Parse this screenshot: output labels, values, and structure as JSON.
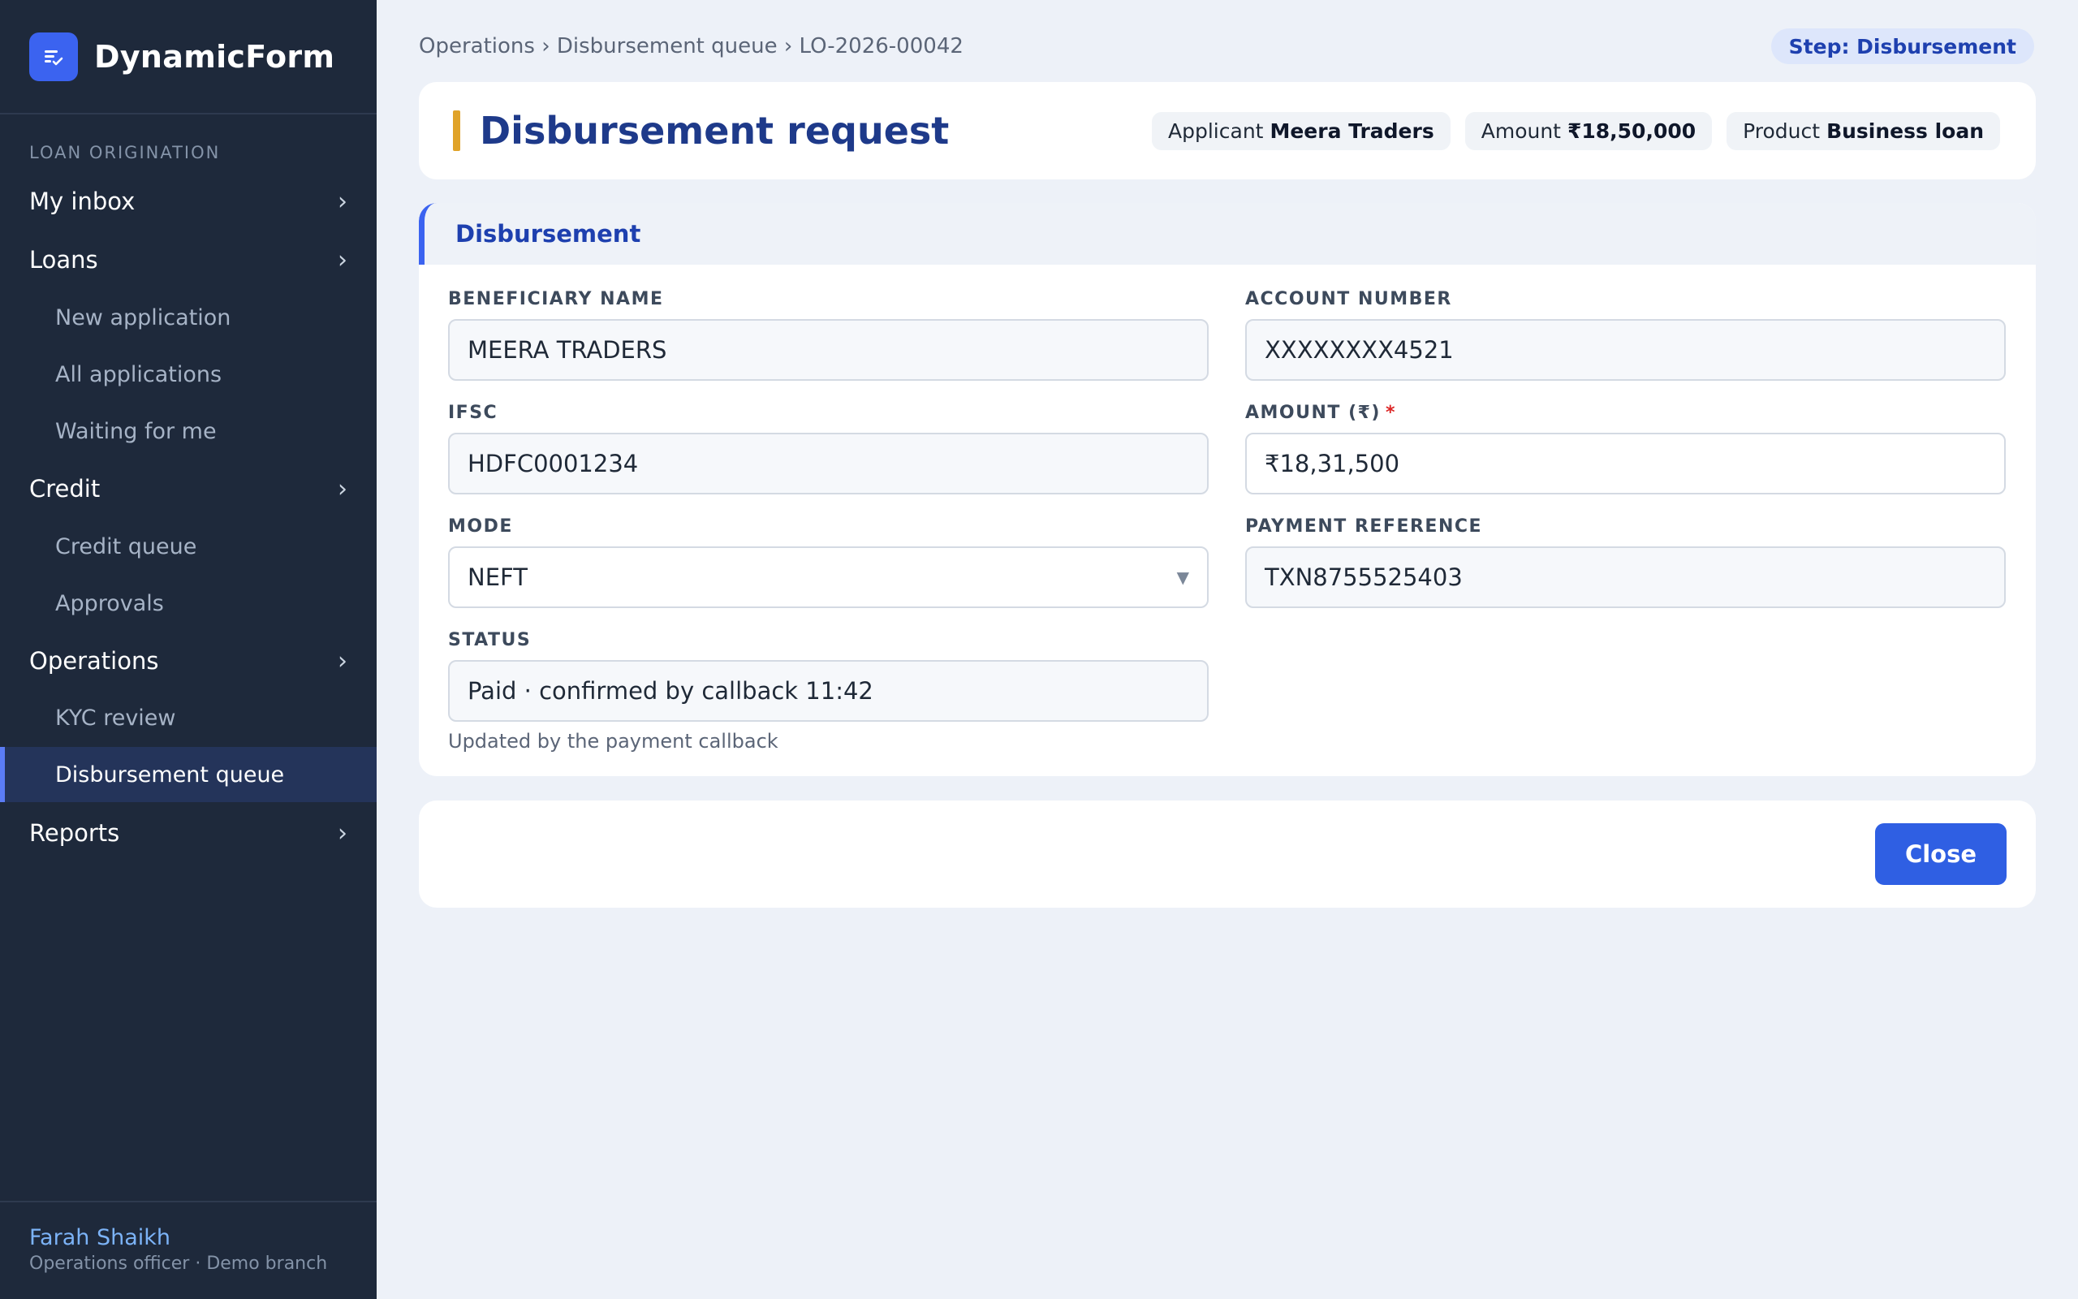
{
  "app": {
    "name": "DynamicForm"
  },
  "sidebar": {
    "section": "LOAN ORIGINATION",
    "items": [
      {
        "label": "My inbox"
      },
      {
        "label": "Loans"
      },
      {
        "label": "New application"
      },
      {
        "label": "All applications"
      },
      {
        "label": "Waiting for me"
      },
      {
        "label": "Credit"
      },
      {
        "label": "Credit queue"
      },
      {
        "label": "Approvals"
      },
      {
        "label": "Operations"
      },
      {
        "label": "KYC review"
      },
      {
        "label": "Disbursement queue"
      },
      {
        "label": "Reports"
      }
    ],
    "active_item": "Disbursement queue",
    "chevron": "›",
    "user": {
      "name": "Farah Shaikh",
      "role": "Operations officer · Demo branch"
    }
  },
  "breadcrumb": "Operations › Disbursement queue › LO-2026-00042",
  "step_badge": "Step: Disbursement",
  "header": {
    "title": "Disbursement request",
    "chips": [
      {
        "key": "Applicant",
        "value": "Meera Traders"
      },
      {
        "key": "Amount",
        "value": "₹18,50,000"
      },
      {
        "key": "Product",
        "value": "Business loan"
      }
    ]
  },
  "form": {
    "section_title": "Disbursement",
    "fields": {
      "beneficiary_name": {
        "label": "BENEFICIARY NAME",
        "value": "MEERA TRADERS"
      },
      "account_number": {
        "label": "ACCOUNT NUMBER",
        "value": "XXXXXXXX4521"
      },
      "ifsc": {
        "label": "IFSC",
        "value": "HDFC0001234"
      },
      "amount": {
        "label": "AMOUNT (₹)",
        "required_mark": "*",
        "value": "₹18,31,500"
      },
      "mode": {
        "label": "MODE",
        "value": "NEFT"
      },
      "payment_reference": {
        "label": "PAYMENT REFERENCE",
        "value": "TXN8755525403"
      },
      "status": {
        "label": "STATUS",
        "value": "Paid · confirmed by callback 11:42",
        "help": "Updated by the payment callback"
      }
    }
  },
  "actions": {
    "close_label": "Close"
  },
  "colors": {
    "sidebar_bg": "#1e293b",
    "accent": "#3b63f0",
    "title": "#1e3a8a",
    "title_bar": "#e0a329",
    "required": "#dc2626"
  },
  "icons": {
    "brand": "form-check-icon",
    "chevron": "chevron-right-icon",
    "select": "caret-down-icon"
  }
}
